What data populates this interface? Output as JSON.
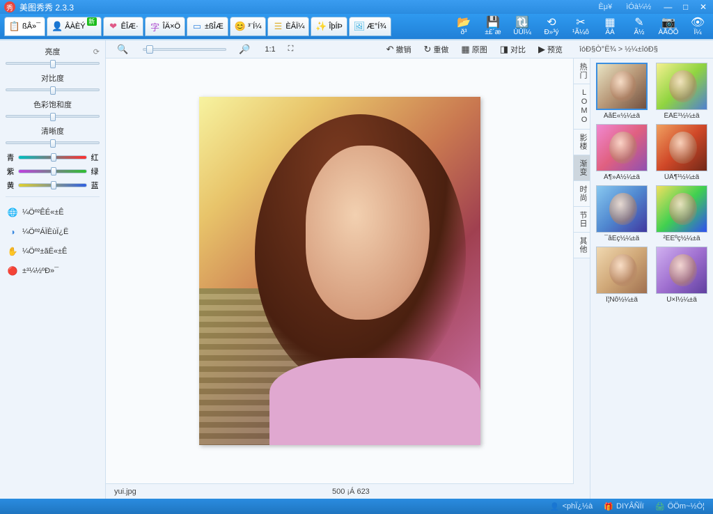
{
  "window": {
    "title": "美图秀秀 2.3.3",
    "top_links": [
      "Èμ¥",
      "ìÓà¼½"
    ],
    "win_min": "—",
    "win_max": "□",
    "win_close": "✕"
  },
  "main_tabs": [
    {
      "label": "ßÂ»¯",
      "icon": "📋",
      "color": "#3a9d3a"
    },
    {
      "label": "ÂÀÈÝ",
      "icon": "👤",
      "color": "#3a9d3a",
      "badge": "新"
    },
    {
      "label": "ÊÎÆ·",
      "icon": "❤",
      "color": "#e05a88"
    },
    {
      "label": "ÎÄ×Ö",
      "icon": "字",
      "color": "#b050d0"
    },
    {
      "label": "±ßÎÆ",
      "icon": "▭",
      "color": "#3a88e0"
    },
    {
      "label": "³¨Í¼",
      "icon": "😊",
      "color": "#e07a3a"
    },
    {
      "label": "ÈÂÏ¼",
      "icon": "☰",
      "color": "#e0b030"
    },
    {
      "label": "ÎþÍÞ",
      "icon": "✨",
      "color": "#b0b0b0"
    },
    {
      "label": "Æ°Í¾",
      "icon": "🖼",
      "color": "#3ab0e0"
    }
  ],
  "toolbar_right": [
    {
      "icon": "📂",
      "label": "ð³"
    },
    {
      "icon": "💾",
      "label": "±£´æ"
    },
    {
      "icon": "🔃",
      "label": "ÙÛÏ¼"
    },
    {
      "icon": "⟲",
      "label": "Ð»³ý"
    },
    {
      "icon": "✂",
      "label": "¹Ã¼ô"
    },
    {
      "icon": "▦",
      "label": "ÃÀ"
    },
    {
      "icon": "✎",
      "label": "Ã½"
    },
    {
      "icon": "📷",
      "label": "ÀÅÕÕ"
    },
    {
      "icon": "👁",
      "label": "Ï¼"
    }
  ],
  "left_sliders": [
    {
      "name": "亮度",
      "pos": 50,
      "reset": true
    },
    {
      "name": "对比度",
      "pos": 50
    },
    {
      "name": "色彩饱和度",
      "pos": 50
    },
    {
      "name": "清晰度",
      "pos": 50
    }
  ],
  "color_sliders": [
    {
      "left": "青",
      "right": "红",
      "grad": "linear-gradient(90deg,#00c0c0,#ff3030)",
      "pos": 50
    },
    {
      "left": "紫",
      "right": "绿",
      "grad": "linear-gradient(90deg,#c040e0,#30c030)",
      "pos": 50
    },
    {
      "left": "黄",
      "right": "蓝",
      "grad": "linear-gradient(90deg,#e0d030,#3060e0)",
      "pos": 50
    }
  ],
  "left_links": [
    {
      "icon": "🌐",
      "color": "#3aa03a",
      "label": "¼Öº²ÊÉ«±Ê"
    },
    {
      "icon": "◑",
      "color": "#3a88e0",
      "label": "¼Öº²ÁÏÈùÏ¿Ë"
    },
    {
      "icon": "✋",
      "color": "#e05050",
      "label": "¼Öº²±ãË«±Ê"
    },
    {
      "icon": "🔴",
      "color": "#e07a3a",
      "label": "±³¼½ºÐ»¯"
    }
  ],
  "canvas_toolbar": {
    "zoom_out": "🔍",
    "zoom_label": "🔎",
    "fit_11": "1:1",
    "fit_screen": "⛶",
    "undo": {
      "icon": "↶",
      "label": "撤销"
    },
    "reset": {
      "icon": "↻",
      "label": "重做"
    },
    "original": {
      "icon": "▦",
      "label": "原图"
    },
    "compare": {
      "icon": "◨",
      "label": "对比"
    },
    "preview": {
      "icon": "▶",
      "label": "预览"
    }
  },
  "status": {
    "filename": "yui.jpg",
    "dimensions": "500 ¡Á 623"
  },
  "right": {
    "breadcrumb": "îóÐ§Ò°Ë¾  >  ½¼±îóÐ§",
    "categories": [
      "热门",
      "LOMO",
      "影楼",
      "渐变",
      "时尚",
      "节日",
      "其他"
    ],
    "active_category": 3,
    "effects": [
      {
        "label": "ÂãË«½¼±ä",
        "selected": true,
        "th": "th0"
      },
      {
        "label": "ËÂÈ¹½¼±ä",
        "th": "th1"
      },
      {
        "label": "Â¶»Ã½¼±ä",
        "th": "th2"
      },
      {
        "label": "ÛÄ¶¹½¼±ä",
        "th": "th3"
      },
      {
        "label": "¯âÉç½¼±ä",
        "th": "th4"
      },
      {
        "label": "²ÊÈºç½¼±ä",
        "th": "th5"
      },
      {
        "label": "Ï¦Ñô½¼±ä",
        "th": "th6"
      },
      {
        "label": "Û×Ï½¼±ä",
        "th": "th7"
      }
    ]
  },
  "footer": [
    {
      "icon": "👤",
      "label": "<phÏ¿½à",
      "color": "#a0d0ff"
    },
    {
      "icon": "🎁",
      "label": "DIYÂÑÏï",
      "color": "#f0c030"
    },
    {
      "icon": "🖨",
      "label": "ÖÖm~½Ò¦",
      "color": "#60d060"
    }
  ]
}
